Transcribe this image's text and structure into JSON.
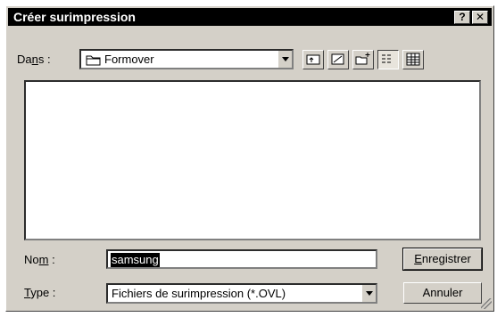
{
  "window": {
    "title": "Créer surimpression",
    "help_label": "?",
    "close_label": "✕"
  },
  "look_in": {
    "label_pre": "Da",
    "label_acc": "n",
    "label_post": "s :",
    "value": "Formover"
  },
  "toolbar": {
    "icons": [
      "up-folder-icon",
      "desktop-icon",
      "new-folder-icon",
      "list-view-icon",
      "details-view-icon"
    ]
  },
  "filename": {
    "label_pre": "No",
    "label_acc": "m",
    "label_post": " :",
    "value": "samsung"
  },
  "filetype": {
    "label_acc": "T",
    "label_post": "ype :",
    "value": "Fichiers de surimpression (*.OVL)"
  },
  "buttons": {
    "save_acc": "E",
    "save_post": "nregistrer",
    "cancel": "Annuler"
  }
}
